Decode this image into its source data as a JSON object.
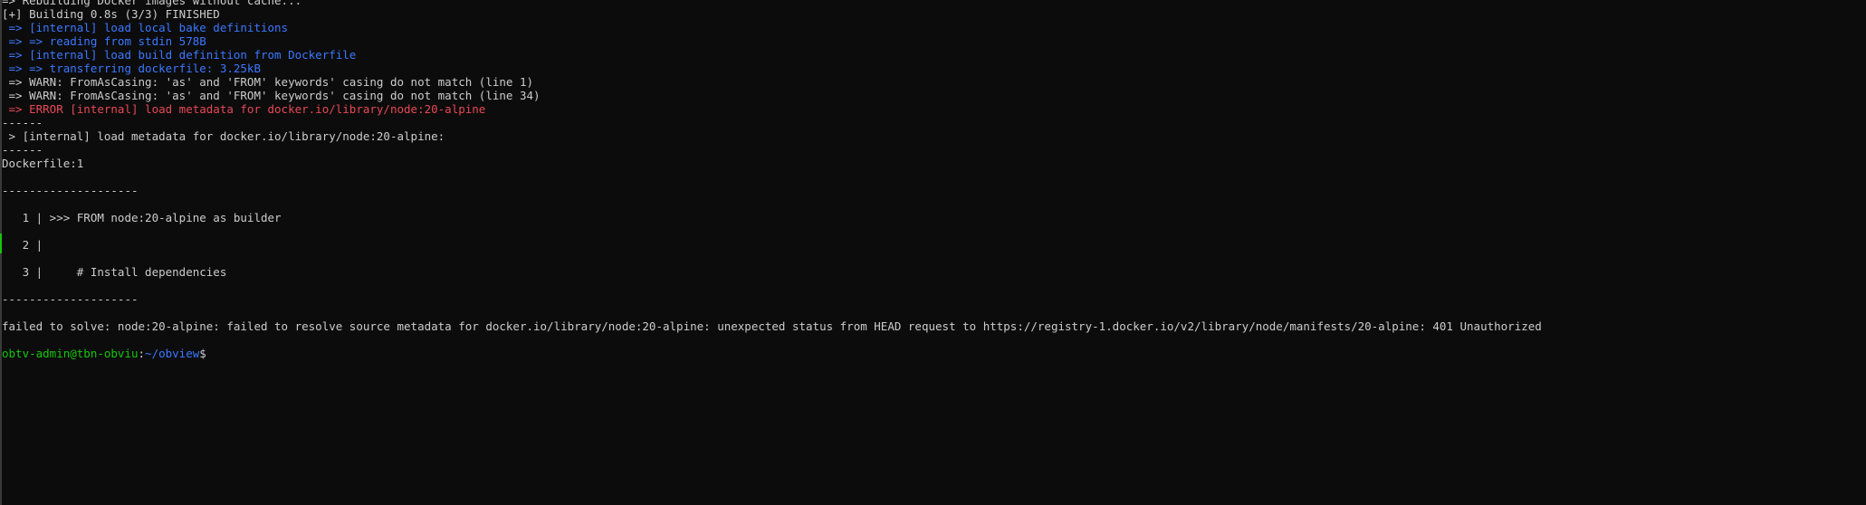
{
  "terminal": {
    "lines": [
      {
        "text": "=> Rebuilding Docker images without cache...",
        "color": "#cccccc"
      },
      {
        "text": "[+] Building 0.8s (3/3) FINISHED",
        "color": "#cccccc"
      },
      {
        "text": " => [internal] load local bake definitions",
        "color": "#3b78ff"
      },
      {
        "text": " => => reading from stdin 578B",
        "color": "#3b78ff"
      },
      {
        "text": " => [internal] load build definition from Dockerfile",
        "color": "#3b78ff"
      },
      {
        "text": " => => transferring dockerfile: 3.25kB",
        "color": "#3b78ff"
      },
      {
        "text": " => WARN: FromAsCasing: 'as' and 'FROM' keywords' casing do not match (line 1)",
        "color": "#cccccc"
      },
      {
        "text": " => WARN: FromAsCasing: 'as' and 'FROM' keywords' casing do not match (line 34)",
        "color": "#cccccc"
      },
      {
        "text": " => ERROR [internal] load metadata for docker.io/library/node:20-alpine",
        "color": "#e74856"
      },
      {
        "text": "------",
        "color": "#cccccc"
      },
      {
        "text": " > [internal] load metadata for docker.io/library/node:20-alpine:",
        "color": "#cccccc"
      },
      {
        "text": "------",
        "color": "#cccccc"
      },
      {
        "text": "Dockerfile:1",
        "color": "#cccccc"
      },
      {
        "text": "",
        "color": "#cccccc"
      },
      {
        "text": "--------------------",
        "color": "#cccccc"
      },
      {
        "text": "",
        "color": "#cccccc"
      },
      {
        "text": "   1 | >>> FROM node:20-alpine as builder",
        "color": "#cccccc"
      },
      {
        "text": "",
        "color": "#cccccc"
      },
      {
        "text": "   2 |",
        "color": "#cccccc"
      },
      {
        "text": "",
        "color": "#cccccc"
      },
      {
        "text": "   3 |     # Install dependencies",
        "color": "#cccccc"
      },
      {
        "text": "",
        "color": "#cccccc"
      },
      {
        "text": "--------------------",
        "color": "#cccccc"
      },
      {
        "text": "",
        "color": "#cccccc"
      },
      {
        "text": "failed to solve: node:20-alpine: failed to resolve source metadata for docker.io/library/node:20-alpine: unexpected status from HEAD request to https://registry-1.docker.io/v2/library/node/manifests/20-alpine: 401 Unauthorized",
        "color": "#cccccc"
      },
      {
        "text": "",
        "color": "#cccccc"
      }
    ],
    "prompt": {
      "user_host": "obtv-admin@tbn-obviu",
      "separator": ":",
      "path": "~/obview",
      "symbol": "$"
    },
    "colors": {
      "background": "#0c0c0c",
      "text": "#cccccc",
      "info": "#3b78ff",
      "error": "#e74856",
      "prompt_user": "#16c60c",
      "prompt_path": "#3b78ff"
    }
  }
}
